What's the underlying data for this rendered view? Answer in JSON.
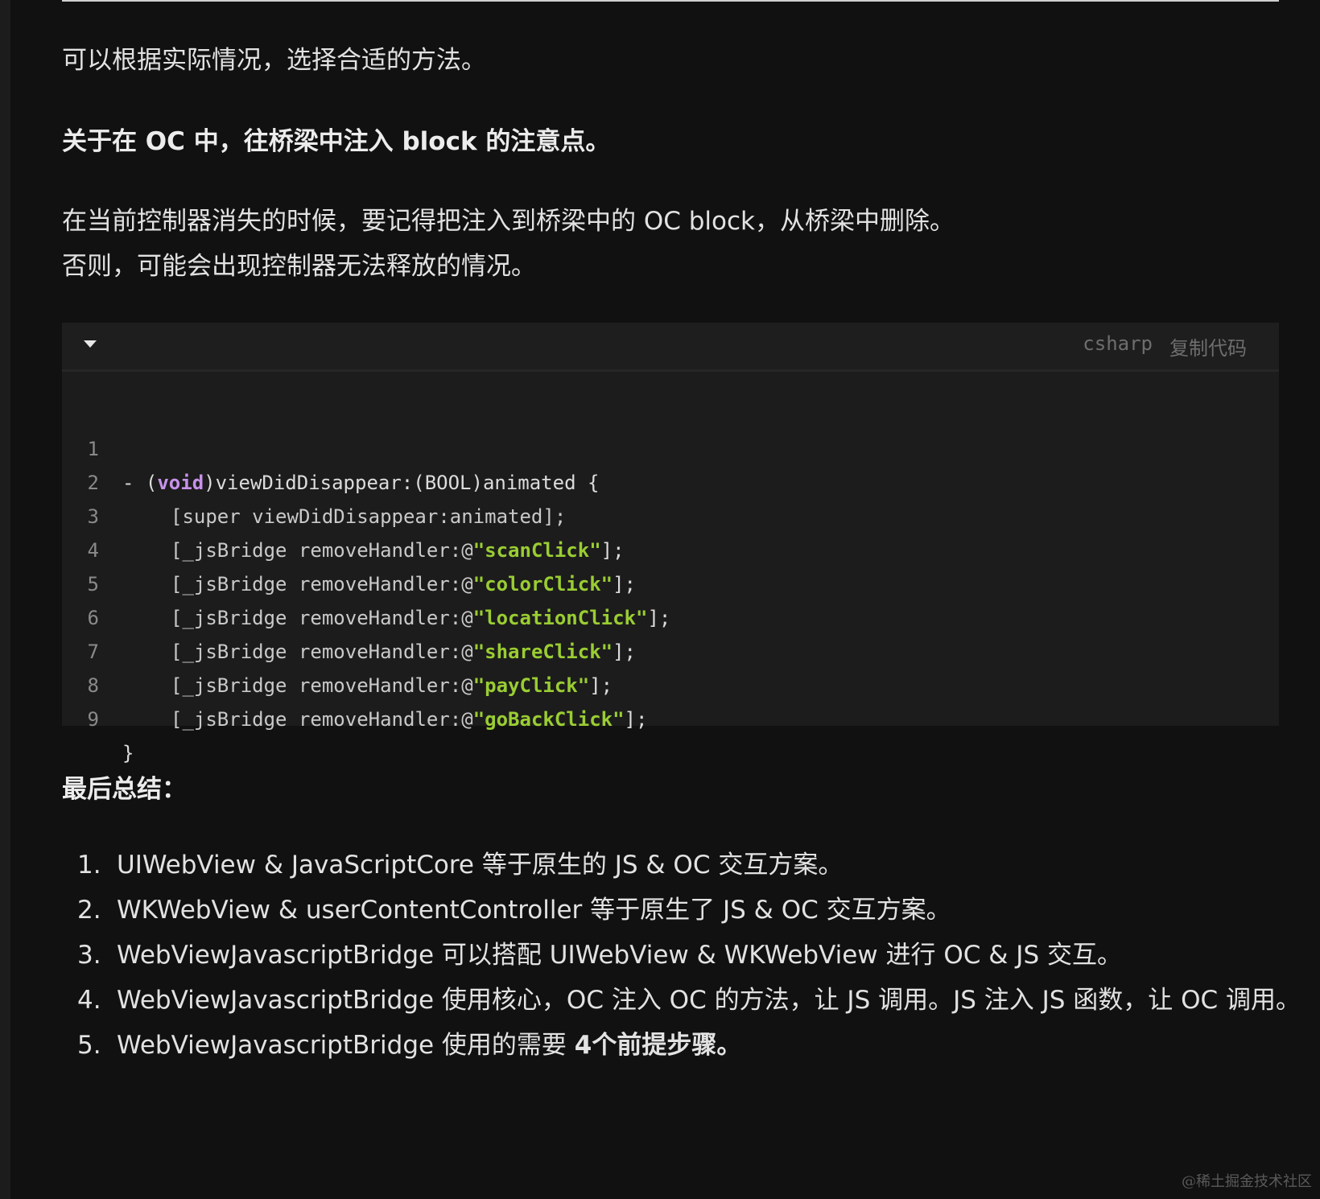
{
  "article": {
    "p1": "可以根据实际情况，选择合适的方法。",
    "heading1": "关于在 OC 中，往桥梁中注入 block 的注意点。",
    "p2": "在当前控制器消失的时候，要记得把注入到桥梁中的 OC block，从桥梁中删除。",
    "p3": "否则，可能会出现控制器无法释放的情况。",
    "heading2": "最后总结："
  },
  "code": {
    "language": "csharp",
    "copy_label": "复制代码",
    "collapse_icon": "caret-down-icon",
    "lines": [
      {
        "n": "1",
        "pre": "- (",
        "kw": "void",
        "post": ")viewDidDisappear:(BOOL)animated {"
      },
      {
        "n": "2",
        "text": "[super viewDidDisappear:animated];"
      },
      {
        "n": "3",
        "obj": "[_jsBridge ",
        "method": "removeHandler:@",
        "str": "\"scanClick\"",
        "end": "];"
      },
      {
        "n": "4",
        "obj": "[_jsBridge ",
        "method": "removeHandler:@",
        "str": "\"colorClick\"",
        "end": "];"
      },
      {
        "n": "5",
        "obj": "[_jsBridge ",
        "method": "removeHandler:@",
        "str": "\"locationClick\"",
        "end": "];"
      },
      {
        "n": "6",
        "obj": "[_jsBridge ",
        "method": "removeHandler:@",
        "str": "\"shareClick\"",
        "end": "];"
      },
      {
        "n": "7",
        "obj": "[_jsBridge ",
        "method": "removeHandler:@",
        "str": "\"payClick\"",
        "end": "];"
      },
      {
        "n": "8",
        "obj": "[_jsBridge ",
        "method": "removeHandler:@",
        "str": "\"goBackClick\"",
        "end": "];"
      },
      {
        "n": "9",
        "text": "}"
      }
    ],
    "colors": {
      "keyword": "#c792ea",
      "string": "#9acd32",
      "background": "#1c1c1c"
    }
  },
  "summary": {
    "items": [
      {
        "num": "1.",
        "text": "UIWebView & JavaScriptCore 等于原生的 JS & OC 交互方案。"
      },
      {
        "num": "2.",
        "text": "WKWebView & userContentController 等于原生了 JS & OC 交互方案。"
      },
      {
        "num": "3.",
        "text": "WebViewJavascriptBridge 可以搭配 UIWebView & WKWebView 进行 OC & JS 交互。"
      },
      {
        "num": "4.",
        "text": "WebViewJavascriptBridge 使用核心，OC 注入 OC 的方法，让 JS 调用。JS 注入 JS 函数，让 OC 调用。"
      },
      {
        "num": "5.",
        "text": "WebViewJavascriptBridge 使用的需要 ",
        "bold": "4个前提步骤。"
      }
    ]
  },
  "watermark": "@稀土掘金技术社区"
}
